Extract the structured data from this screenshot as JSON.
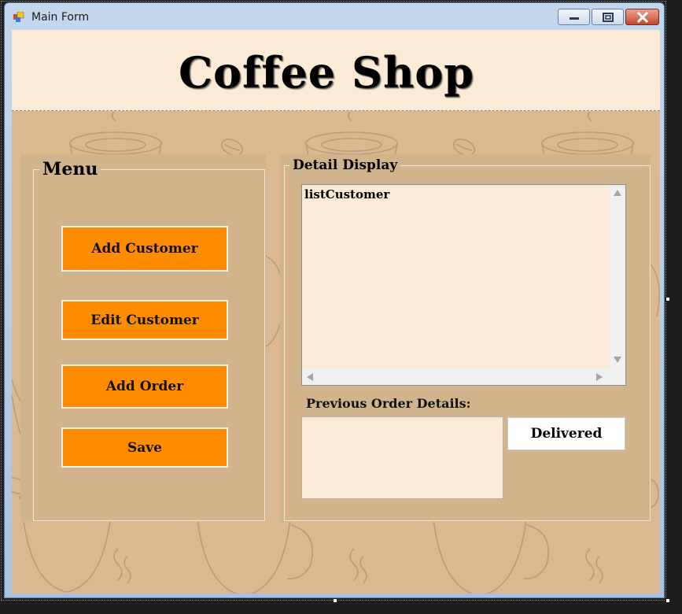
{
  "window": {
    "title": "Main Form",
    "app_icon": "winforms-app-icon",
    "controls": {
      "minimize_icon": "minimize-icon",
      "maximize_icon": "maximize-icon",
      "close_icon": "close-icon"
    }
  },
  "header": {
    "title": "Coffee Shop"
  },
  "menu": {
    "legend": "Menu",
    "buttons": {
      "add_customer": "Add Customer",
      "edit_customer": "Edit Customer",
      "add_order": "Add Order",
      "save": "Save"
    }
  },
  "detail": {
    "legend": "Detail Display",
    "list_text": "listCustomer",
    "previous_orders_label": "Previous Order Details:",
    "delivered_label": "Delivered"
  },
  "colors": {
    "button_orange": "#ff8c00",
    "panel_tan": "#d2b48c",
    "background_tan": "#dcb891",
    "header_cream": "#fbead5",
    "list_cream": "#faebd7"
  }
}
